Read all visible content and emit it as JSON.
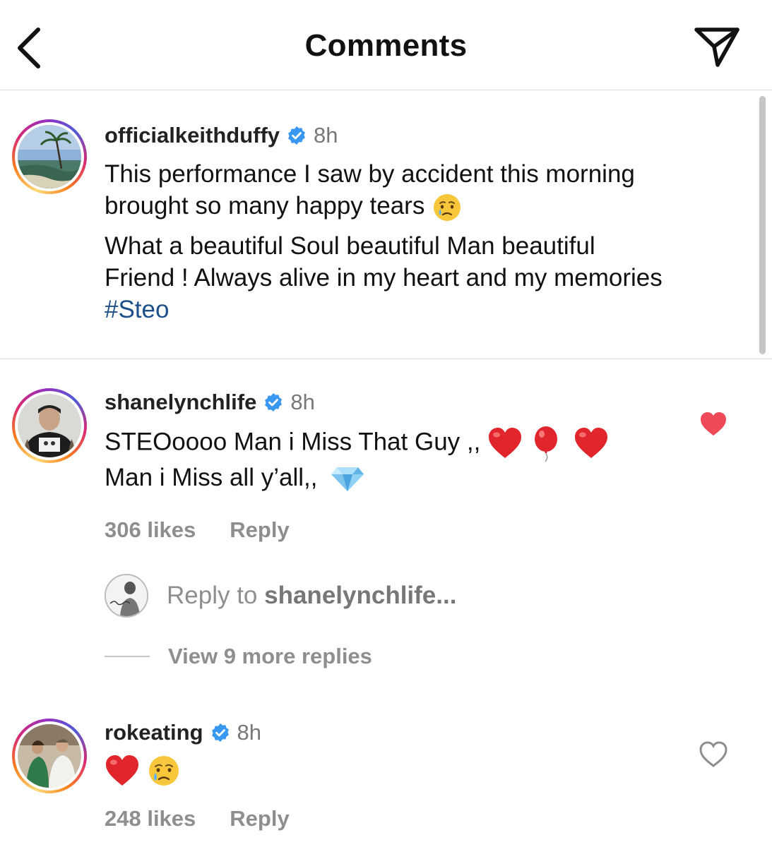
{
  "header": {
    "title": "Comments"
  },
  "caption": {
    "username": "officialkeithduffy",
    "time": "8h",
    "line1": "This performance I saw by accident this morning",
    "line2": "brought so many happy tears",
    "line3": "What a beautiful Soul beautiful Man beautiful",
    "line4": "Friend ! Always alive in my heart and my memories",
    "hashtag": "#Steo"
  },
  "comments": [
    {
      "username": "shanelynchlife",
      "time": "8h",
      "line1": "STEOoooo Man i Miss That Guy ,,",
      "line2": "Man i Miss all y’all,,",
      "likes": "306 likes",
      "reply_label": "Reply",
      "liked": true
    },
    {
      "username": "rokeating",
      "time": "8h",
      "likes": "248 likes",
      "reply_label": "Reply",
      "liked": false
    }
  ],
  "reply_box": {
    "prefix": "Reply to ",
    "target": "shanelynchlife..."
  },
  "view_more": {
    "label": "View 9 more replies"
  },
  "icons": {
    "back": "chevron-left-icon",
    "send": "paper-plane-icon",
    "verified": "verified-badge-icon",
    "heart": "heart-icon"
  },
  "colors": {
    "verified": "#3897f0",
    "liked_heart": "#ed4956",
    "hashtag": "#1d4f8a",
    "muted": "#8e8e8e"
  }
}
